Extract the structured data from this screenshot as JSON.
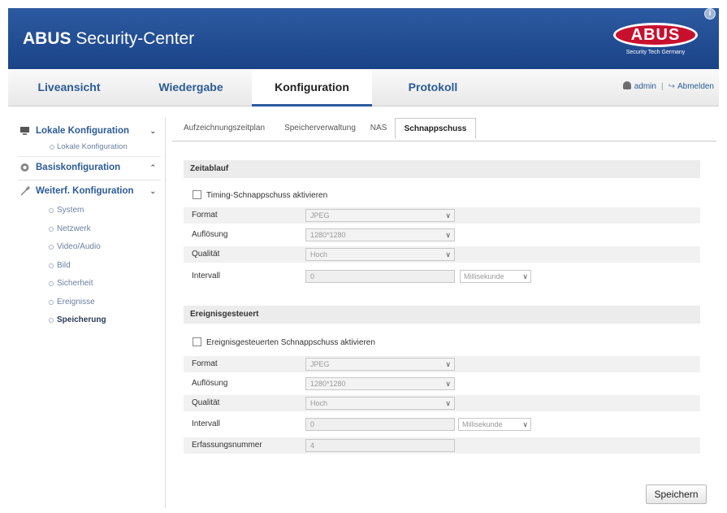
{
  "header": {
    "title_brand": "ABUS",
    "title_rest": " Security-Center",
    "logo_text": "ABUS",
    "logo_sub": "Security Tech Germany",
    "info_label": "i"
  },
  "nav": {
    "tabs": [
      {
        "label": "Liveansicht"
      },
      {
        "label": "Wiedergabe"
      },
      {
        "label": "Konfiguration",
        "active": true
      },
      {
        "label": "Protokoll"
      }
    ],
    "user": "admin",
    "separator": "|",
    "logout": "Abmelden"
  },
  "sidebar": {
    "groups": [
      {
        "label": "Lokale Konfiguration",
        "chevron": "⌄",
        "items": [
          {
            "label": "Lokale Konfiguration"
          }
        ]
      },
      {
        "label": "Basiskonfiguration",
        "chevron": "⌃"
      },
      {
        "label": "Weiterf. Konfiguration",
        "chevron": "⌄",
        "items": [
          {
            "label": "System"
          },
          {
            "label": "Netzwerk"
          },
          {
            "label": "Video/Audio"
          },
          {
            "label": "Bild"
          },
          {
            "label": "Sicherheit"
          },
          {
            "label": "Ereignisse"
          },
          {
            "label": "Speicherung",
            "active": true
          }
        ]
      }
    ]
  },
  "subtabs": [
    {
      "label": "Aufzeichnungszeitplan"
    },
    {
      "label": "Speicherverwaltung"
    },
    {
      "label": "NAS"
    },
    {
      "label": "Schnappschuss",
      "active": true
    }
  ],
  "timing": {
    "heading": "Zeitablauf",
    "checkbox_label": "Timing-Schnappschuss aktivieren",
    "format_label": "Format",
    "format_value": "JPEG",
    "resolution_label": "Auflösung",
    "resolution_value": "1280*1280",
    "quality_label": "Qualität",
    "quality_value": "Hoch",
    "interval_label": "Intervall",
    "interval_value": "0",
    "interval_unit": "Millisekunde"
  },
  "event": {
    "heading": "Ereignisgesteuert",
    "checkbox_label": "Ereignisgesteuerten Schnappschuss aktivieren",
    "format_label": "Format",
    "format_value": "JPEG",
    "resolution_label": "Auflösung",
    "resolution_value": "1280*1280",
    "quality_label": "Qualität",
    "quality_value": "Hoch",
    "interval_label": "Intervall",
    "interval_value": "0",
    "interval_unit": "Millisekunde",
    "capture_label": "Erfassungsnummer",
    "capture_value": "4"
  },
  "save_label": "Speichern",
  "colors": {
    "header_blue": "#1f4a92",
    "logo_red": "#c8102e",
    "nav_link": "#2b5b96"
  }
}
